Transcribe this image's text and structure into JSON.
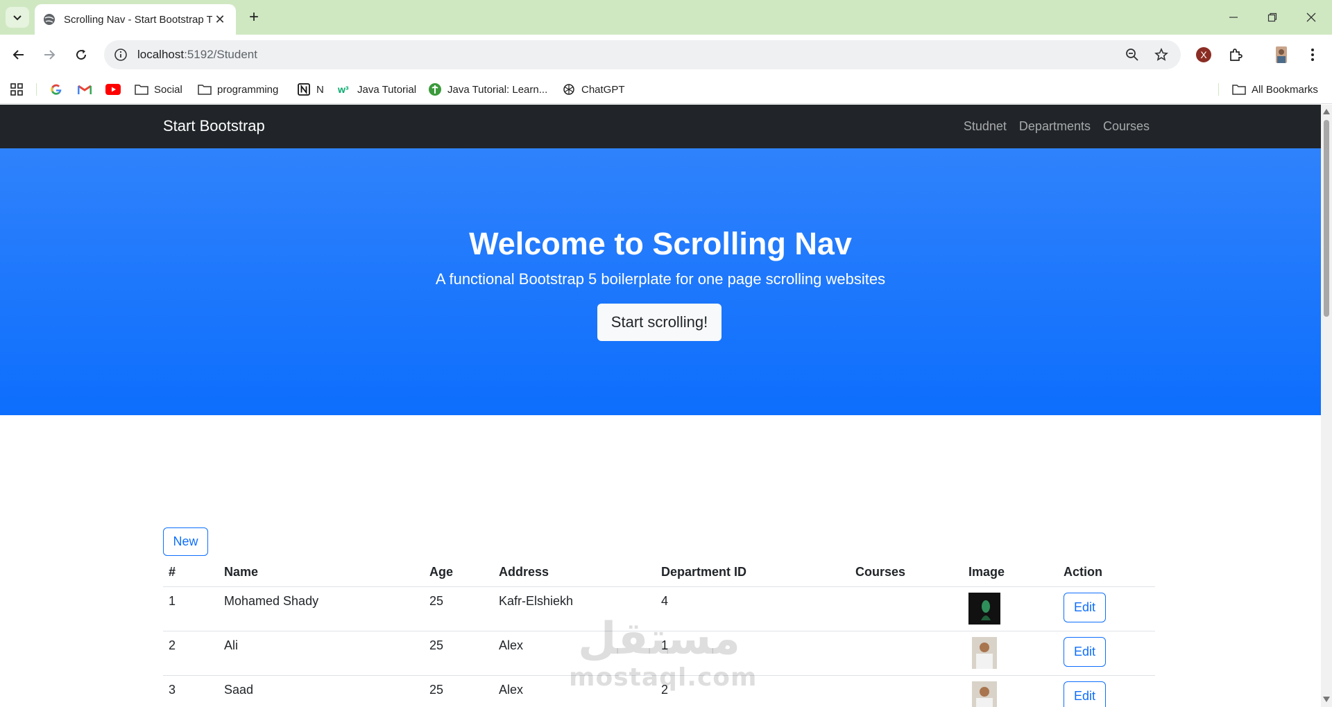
{
  "browser": {
    "tab_title": "Scrolling Nav - Start Bootstrap T",
    "url_host": "localhost",
    "url_path": ":5192/Student",
    "bookmarks": [
      {
        "label": "",
        "icon": "google-icon"
      },
      {
        "label": "",
        "icon": "gmail-icon"
      },
      {
        "label": "",
        "icon": "youtube-icon"
      },
      {
        "label": "Social",
        "icon": "folder-icon"
      },
      {
        "label": "programming",
        "icon": "folder-icon"
      },
      {
        "label": "N",
        "icon": "notion-icon"
      },
      {
        "label": "Java Tutorial",
        "icon": "w3schools-icon"
      },
      {
        "label": "Java Tutorial: Learn...",
        "icon": "site-icon"
      },
      {
        "label": "ChatGPT",
        "icon": "chatgpt-icon"
      }
    ],
    "all_bookmarks": "All Bookmarks",
    "profile_initial": "X"
  },
  "site": {
    "brand": "Start Bootstrap",
    "nav": [
      "Studnet",
      "Departments",
      "Courses"
    ],
    "hero_title": "Welcome to Scrolling Nav",
    "hero_subtitle": "A functional Bootstrap 5 boilerplate for one page scrolling websites",
    "hero_button": "Start scrolling!",
    "new_button": "New"
  },
  "table": {
    "headers": [
      "#",
      "Name",
      "Age",
      "Address",
      "Department ID",
      "Courses",
      "Image",
      "Action"
    ],
    "rows": [
      {
        "id": "1",
        "name": "Mohamed Shady",
        "age": "25",
        "address": "Kafr-Elshiekh",
        "dept": "4",
        "courses": "",
        "action": "Edit"
      },
      {
        "id": "2",
        "name": "Ali",
        "age": "25",
        "address": "Alex",
        "dept": "1",
        "courses": "",
        "action": "Edit"
      },
      {
        "id": "3",
        "name": "Saad",
        "age": "25",
        "address": "Alex",
        "dept": "2",
        "courses": "",
        "action": "Edit"
      }
    ]
  },
  "watermark": {
    "arabic": "مستقل",
    "latin": "mostaql.com"
  },
  "colors": {
    "primary": "#0d6efd",
    "navbar": "#212529",
    "tabstrip": "#cfe8c2"
  }
}
